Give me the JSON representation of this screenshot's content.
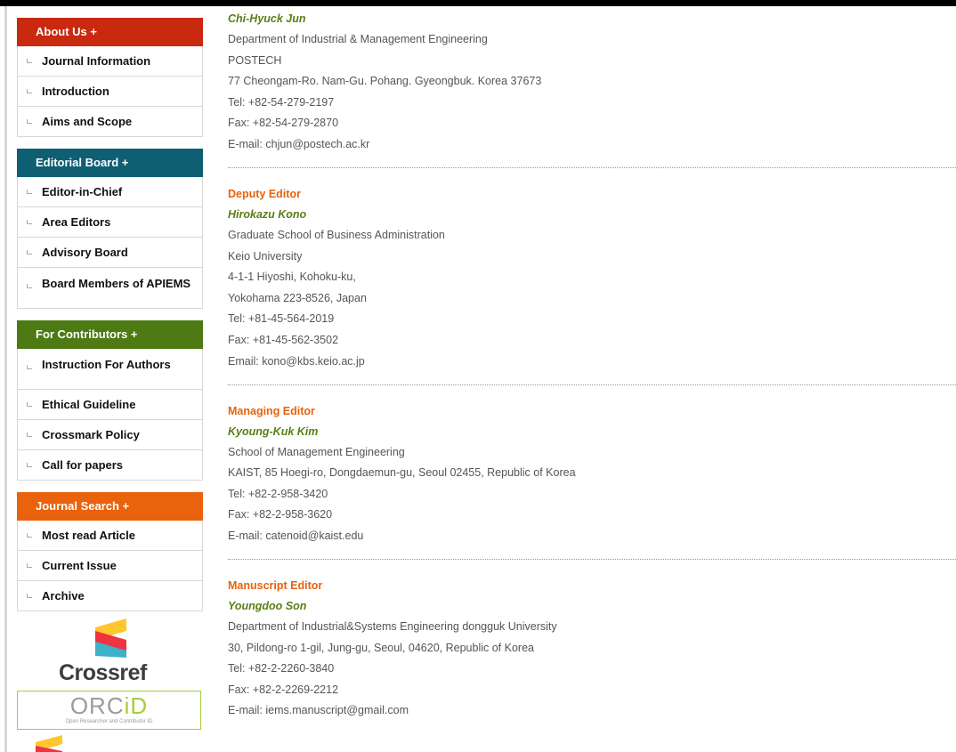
{
  "sidebar": {
    "groups": [
      {
        "title": "About Us +",
        "color": "#c8290f",
        "items": [
          "Journal Information",
          "Introduction",
          "Aims and Scope"
        ]
      },
      {
        "title": "Editorial Board +",
        "color": "#0f5f73",
        "items": [
          "Editor-in-Chief",
          "Area Editors",
          "Advisory Board",
          "Board Members of APIEMS"
        ]
      },
      {
        "title": "For Contributors +",
        "color": "#4d7a13",
        "items": [
          "Instruction For Authors",
          "Ethical Guideline",
          "Crossmark Policy",
          "Call for papers"
        ]
      },
      {
        "title": "Journal Search +",
        "color": "#e9620c",
        "items": [
          "Most read Article",
          "Current Issue",
          "Archive"
        ]
      }
    ]
  },
  "logos": {
    "crossref": "Crossref",
    "orcid_main": "ORC",
    "orcid_id": "iD",
    "orcid_sub": "Open Researcher and Contributor ID"
  },
  "editors": [
    {
      "role": "",
      "name": "Chi-Hyuck Jun",
      "lines": [
        "Department of Industrial & Management Engineering",
        "POSTECH",
        "77 Cheongam-Ro. Nam-Gu. Pohang. Gyeongbuk. Korea 37673",
        "Tel: +82-54-279-2197",
        "Fax: +82-54-279-2870",
        "E-mail: chjun@postech.ac.kr"
      ]
    },
    {
      "role": "Deputy Editor",
      "name": "Hirokazu Kono",
      "lines": [
        "Graduate School of Business Administration",
        "Keio University",
        "4-1-1 Hiyoshi, Kohoku-ku,",
        "Yokohama 223-8526, Japan",
        "Tel: +81-45-564-2019",
        "Fax: +81-45-562-3502",
        "Email: kono@kbs.keio.ac.jp"
      ]
    },
    {
      "role": "Managing Editor",
      "name": "Kyoung-Kuk Kim",
      "lines": [
        "School of Management Engineering",
        "KAIST, 85 Hoegi-ro, Dongdaemun-gu, Seoul 02455, Republic of Korea",
        "Tel: +82-2-958-3420",
        "Fax: +82-2-958-3620",
        "E-mail: catenoid@kaist.edu"
      ]
    },
    {
      "role": "Manuscript Editor",
      "name": "Youngdoo Son",
      "lines": [
        "Department of Industrial&Systems Engineering dongguk University",
        "30, Pildong-ro 1-gil, Jung-gu, Seoul, 04620, Republic of Korea",
        "Tel: +82-2-2260-3840",
        "Fax: +82-2-2269-2212",
        "E-mail: iems.manuscript@gmail.com"
      ]
    }
  ]
}
